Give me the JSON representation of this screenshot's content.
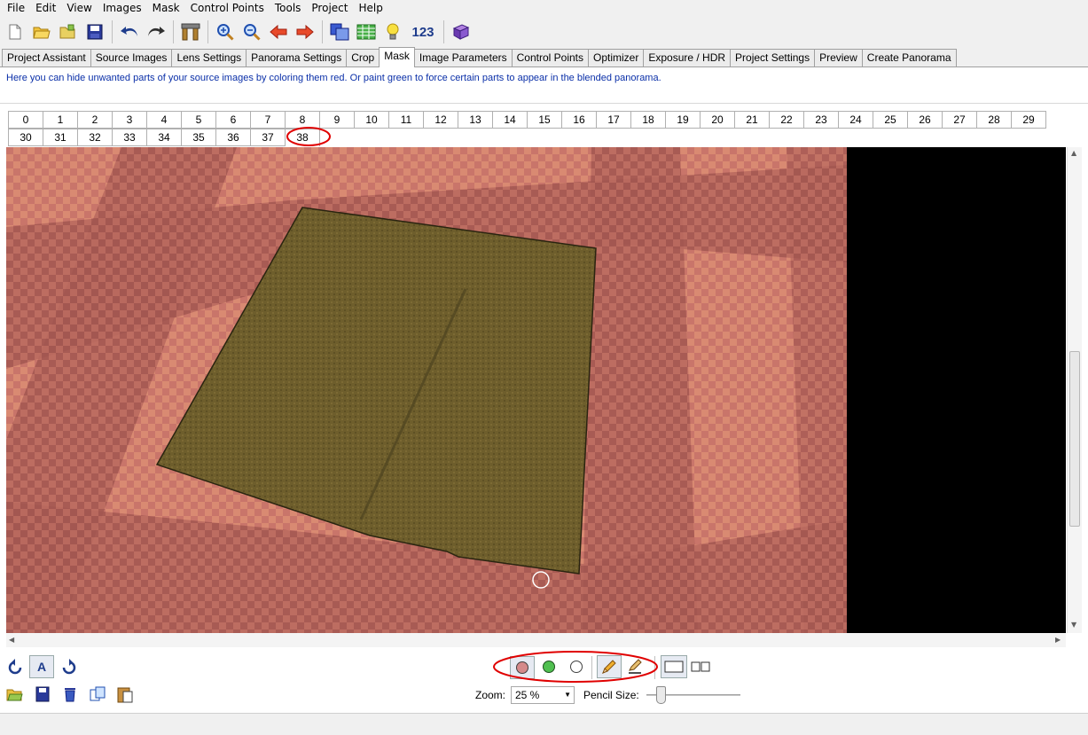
{
  "menu": [
    "File",
    "Edit",
    "View",
    "Images",
    "Mask",
    "Control Points",
    "Tools",
    "Project",
    "Help"
  ],
  "toolbar": {
    "icons": [
      "new-file-icon",
      "open-folder-icon",
      "open-recent-icon",
      "save-icon",
      "undo-icon",
      "redo-icon",
      "assistant-tools-icon",
      "zoom-in-icon",
      "zoom-out-icon",
      "previous-arrow-icon",
      "next-arrow-icon",
      "preview-window-icon",
      "table-icon",
      "lightbulb-icon",
      "book-icon"
    ],
    "number_button": "123"
  },
  "tabs": [
    {
      "label": "Project Assistant",
      "active": false
    },
    {
      "label": "Source Images",
      "active": false
    },
    {
      "label": "Lens Settings",
      "active": false
    },
    {
      "label": "Panorama Settings",
      "active": false
    },
    {
      "label": "Crop",
      "active": false
    },
    {
      "label": "Mask",
      "active": true
    },
    {
      "label": "Image Parameters",
      "active": false
    },
    {
      "label": "Control Points",
      "active": false
    },
    {
      "label": "Optimizer",
      "active": false
    },
    {
      "label": "Exposure / HDR",
      "active": false
    },
    {
      "label": "Project Settings",
      "active": false
    },
    {
      "label": "Preview",
      "active": false
    },
    {
      "label": "Create Panorama",
      "active": false
    }
  ],
  "hint": "Here you can hide unwanted parts of your source images by coloring them red. Or paint green to force certain parts to appear in the blended panorama.",
  "image_tabs": {
    "row1": [
      "0",
      "1",
      "2",
      "3",
      "4",
      "5",
      "6",
      "7",
      "8",
      "9",
      "10",
      "11",
      "12",
      "13",
      "14",
      "15",
      "16",
      "17",
      "18",
      "19",
      "20",
      "21",
      "22",
      "23",
      "24",
      "25",
      "26",
      "27",
      "28",
      "29"
    ],
    "row2": [
      "30",
      "31",
      "32",
      "33",
      "34",
      "35",
      "36",
      "37",
      "38"
    ],
    "selected": "38"
  },
  "bottom_left_icons": [
    "rotate-left-icon",
    "auto-mask-icon",
    "rotate-right-icon",
    "load-mask-icon",
    "save-mask-icon",
    "delete-mask-icon",
    "copy-mask-icon",
    "paste-mask-icon"
  ],
  "auto_mask_label": "A",
  "brush_icons": [
    "red-brush-icon",
    "green-brush-icon",
    "clear-brush-icon",
    "pencil-icon",
    "eraser-brush-icon",
    "single-view-icon",
    "dual-view-icon"
  ],
  "zoom": {
    "label": "Zoom:",
    "value": "25 %"
  },
  "pencil": {
    "label": "Pencil Size:",
    "value_fraction": 0.12
  },
  "colors": {
    "mask_red": "#d9866e",
    "mask_red_dark": "#b0605a",
    "image_region": "#6b5a2a",
    "hint_blue": "#0a2fa8",
    "annotation_red": "#e00000"
  }
}
